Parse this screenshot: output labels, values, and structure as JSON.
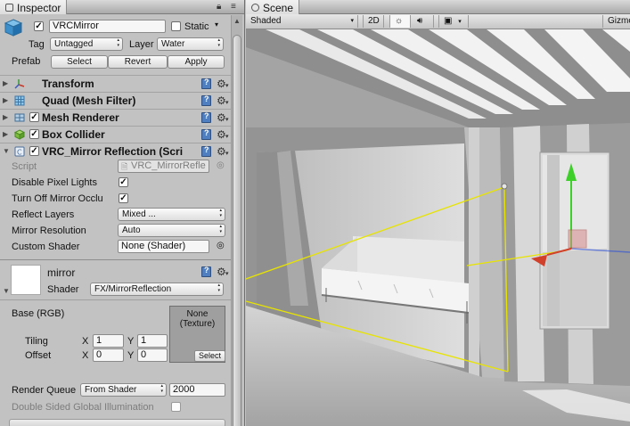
{
  "inspector": {
    "tab_label": "Inspector",
    "object_name": "VRCMirror",
    "static_label": "Static",
    "tag_label": "Tag",
    "tag_value": "Untagged",
    "layer_label": "Layer",
    "layer_value": "Water",
    "prefab_label": "Prefab",
    "prefab_buttons": {
      "select": "Select",
      "revert": "Revert",
      "apply": "Apply"
    },
    "components": {
      "transform": "Transform",
      "quad": "Quad (Mesh Filter)",
      "mesh_renderer": "Mesh Renderer",
      "box_collider": "Box Collider",
      "mirror": "VRC_Mirror Reflection (Scri"
    },
    "mirror_props": {
      "script_label": "Script",
      "script_value": "VRC_MirrorRefle",
      "disable_pixel_lights": "Disable Pixel Lights",
      "turn_off_occlusion": "Turn Off Mirror Occlu",
      "reflect_layers_label": "Reflect Layers",
      "reflect_layers_value": "Mixed ...",
      "mirror_resolution_label": "Mirror Resolution",
      "mirror_resolution_value": "Auto",
      "custom_shader_label": "Custom Shader",
      "custom_shader_value": "None (Shader)"
    },
    "material": {
      "name": "mirror",
      "shader_label": "Shader",
      "shader_value": "FX/MirrorReflection",
      "base_label": "Base (RGB)",
      "tiling_label": "Tiling",
      "offset_label": "Offset",
      "x_label": "X",
      "y_label": "Y",
      "tiling_x": "1",
      "tiling_y": "1",
      "offset_x": "0",
      "offset_y": "0",
      "texture_none": "None",
      "texture_type": "(Texture)",
      "texture_select": "Select",
      "render_queue_label": "Render Queue",
      "render_queue_mode": "From Shader",
      "render_queue_value": "2000",
      "double_sided_gi": "Double Sided Global Illumination"
    }
  },
  "scene": {
    "tab_label": "Scene",
    "shading_mode": "Shaded",
    "mode_2d": "2D",
    "gizmos_label": "Gizmo"
  }
}
